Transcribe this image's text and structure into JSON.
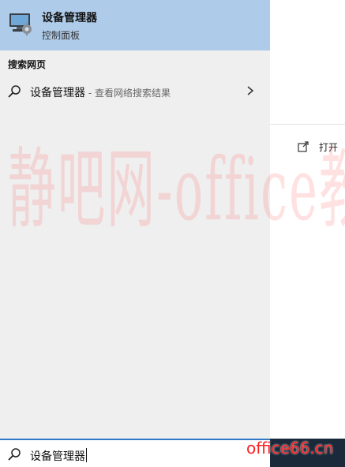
{
  "best_match": {
    "title": "设备管理器",
    "subtitle": "控制面板",
    "icon": "device-manager-icon"
  },
  "web_section": {
    "heading": "搜索网页",
    "item_query": "设备管理器",
    "item_suffix": " - 查看网络搜索结果",
    "search_icon": "search-icon",
    "chevron_icon": "chevron-right-icon"
  },
  "right_pane": {
    "open_label": "打开",
    "open_icon": "open-icon"
  },
  "search_box": {
    "value": "设备管理器",
    "icon": "search-icon"
  },
  "watermark": {
    "text": "静吧网-office教程网",
    "site": "office66.cn"
  },
  "colors": {
    "highlight": "#aecbe9",
    "search_border": "#2f78c5",
    "pane_bg": "#efefef",
    "watermark": "#ff2020"
  }
}
